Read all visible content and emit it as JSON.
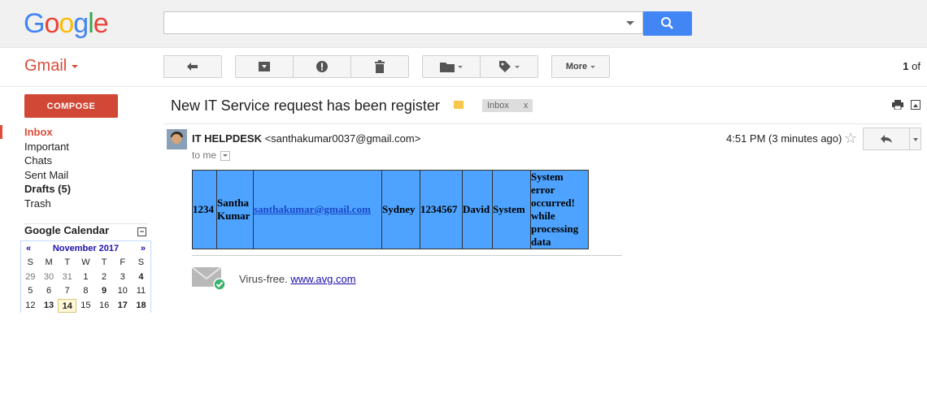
{
  "header": {
    "logo_letters": [
      {
        "ch": "G",
        "color": "#4285f4"
      },
      {
        "ch": "o",
        "color": "#ea4335"
      },
      {
        "ch": "o",
        "color": "#fbbc05"
      },
      {
        "ch": "g",
        "color": "#4285f4"
      },
      {
        "ch": "l",
        "color": "#34a853"
      },
      {
        "ch": "e",
        "color": "#ea4335"
      }
    ],
    "search_value": ""
  },
  "toolbar": {
    "app_label": "Gmail",
    "more_label": "More",
    "pager_current": "1",
    "pager_of": "of"
  },
  "sidebar": {
    "compose_label": "COMPOSE",
    "items": [
      {
        "label": "Inbox",
        "state": "active"
      },
      {
        "label": "Important",
        "state": ""
      },
      {
        "label": "Chats",
        "state": ""
      },
      {
        "label": "Sent Mail",
        "state": ""
      },
      {
        "label": "Drafts (5)",
        "state": "bold"
      },
      {
        "label": "Trash",
        "state": ""
      }
    ],
    "calendar": {
      "title": "Google Calendar",
      "month": "November 2017",
      "prev": "«",
      "next": "»",
      "weekdays": [
        "S",
        "M",
        "T",
        "W",
        "T",
        "F",
        "S"
      ],
      "days": [
        {
          "d": "29",
          "c": "dim"
        },
        {
          "d": "30",
          "c": "dim"
        },
        {
          "d": "31",
          "c": "dim"
        },
        {
          "d": "1",
          "c": ""
        },
        {
          "d": "2",
          "c": ""
        },
        {
          "d": "3",
          "c": ""
        },
        {
          "d": "4",
          "c": "b"
        },
        {
          "d": "5",
          "c": ""
        },
        {
          "d": "6",
          "c": ""
        },
        {
          "d": "7",
          "c": ""
        },
        {
          "d": "8",
          "c": ""
        },
        {
          "d": "9",
          "c": "b"
        },
        {
          "d": "10",
          "c": ""
        },
        {
          "d": "11",
          "c": ""
        },
        {
          "d": "12",
          "c": ""
        },
        {
          "d": "13",
          "c": "b"
        },
        {
          "d": "14",
          "c": "today"
        },
        {
          "d": "15",
          "c": ""
        },
        {
          "d": "16",
          "c": ""
        },
        {
          "d": "17",
          "c": "b"
        },
        {
          "d": "18",
          "c": "b"
        }
      ]
    }
  },
  "message": {
    "subject": "New IT Service request has been register",
    "label_chip": "Inbox",
    "label_chip_close": "x",
    "sender_name": "IT HELPDESK",
    "sender_email": "<santhakumar0037@gmail.com>",
    "to": "to me",
    "time": "4:51 PM (3 minutes ago)",
    "table_cells": [
      {
        "text": "1234",
        "width": 29,
        "link": false
      },
      {
        "text": "Santha Kumar",
        "width": 44,
        "link": false
      },
      {
        "text": "santhakumar@gmail.com",
        "width": 157,
        "link": true
      },
      {
        "text": "Sydney",
        "width": 46,
        "link": false
      },
      {
        "text": "1234567",
        "width": 51,
        "link": false
      },
      {
        "text": "David",
        "width": 36,
        "link": false
      },
      {
        "text": "System",
        "width": 46,
        "link": false
      },
      {
        "text": "System error occurred! while processing data",
        "width": 70,
        "link": false
      }
    ],
    "footer_text": "Virus-free.",
    "footer_link": "www.avg.com"
  }
}
